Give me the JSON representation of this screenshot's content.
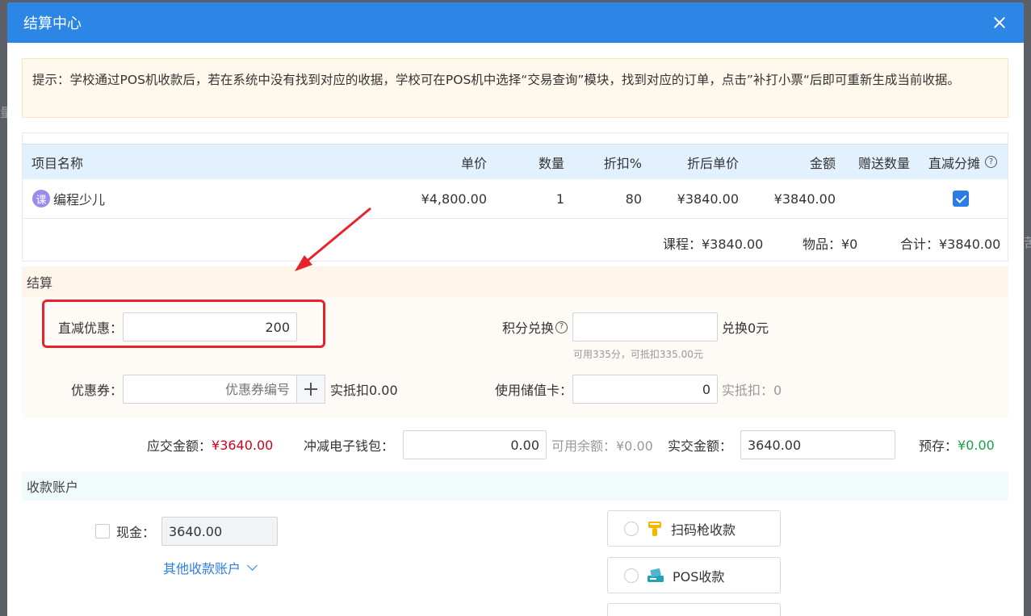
{
  "background": {
    "left_text": "量",
    "right_text": "苦"
  },
  "modal": {
    "title": "结算中心"
  },
  "tip": {
    "label": "提示：",
    "text": "学校通过POS机收款后，若在系统中没有找到对应的收据，学校可在POS机中选择“交易查询”模块，找到对应的订单，点击”补打小票“后即可重新生成当前收据。"
  },
  "table": {
    "headers": {
      "name": "项目名称",
      "price": "单价",
      "qty": "数量",
      "discount": "折扣%",
      "disc_price": "折后单价",
      "amount": "金额",
      "gift": "赠送数量",
      "direct_split": "直减分摊"
    },
    "rows": [
      {
        "badge": "课",
        "name": "编程少儿",
        "price": "¥4,800.00",
        "qty": "1",
        "discount": "80",
        "disc_price": "¥3840.00",
        "amount": "¥3840.00",
        "gift": "",
        "direct_split_checked": true
      }
    ]
  },
  "totals": {
    "course": "课程：¥3840.00",
    "goods": "物品：¥0",
    "sum": "合计：¥3840.00"
  },
  "settle": {
    "title": "结算",
    "direct_label": "直减优惠：",
    "direct_value": "200",
    "points_label": "积分兑换",
    "points_value": "",
    "points_exchange": "兑换0元",
    "points_note": "可用335分，可抵扣335.00元",
    "coupon_label": "优惠券：",
    "coupon_placeholder": "优惠券编号",
    "coupon_deduct": "实抵扣0.00",
    "card_label": "使用储值卡：",
    "card_value": "0",
    "card_deduct": "实抵扣：0"
  },
  "summary": {
    "due_label": "应交金额：",
    "due_value": "¥3640.00",
    "wallet_label": "冲减电子钱包：",
    "wallet_value": "0.00",
    "wallet_balance": "可用余额：¥0.00",
    "paid_label": "实交金额：",
    "paid_value": "3640.00",
    "prestore_label": "预存：",
    "prestore_value": "¥0.00"
  },
  "accounts": {
    "title": "收款账户",
    "cash_label": "现金：",
    "cash_value": "3640.00",
    "other_link": "其他收款账户",
    "scan_label": "扫码枪收款",
    "pos_label": "POS收款"
  },
  "colors": {
    "header": "#2b86e6",
    "red": "#d0021b",
    "green": "#19a04b",
    "link": "#2b7de3"
  }
}
